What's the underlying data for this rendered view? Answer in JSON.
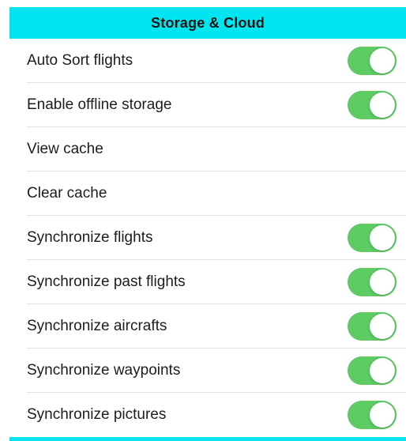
{
  "header": {
    "title": "Storage & Cloud"
  },
  "colors": {
    "header_bg": "#00e6f0",
    "toggle_on": "#5ecb63",
    "divider": "#e3e3e3"
  },
  "settings": [
    {
      "label": "Auto Sort flights",
      "has_toggle": true,
      "on": true
    },
    {
      "label": "Enable offline storage",
      "has_toggle": true,
      "on": true
    },
    {
      "label": "View cache",
      "has_toggle": false
    },
    {
      "label": "Clear cache",
      "has_toggle": false
    },
    {
      "label": "Synchronize flights",
      "has_toggle": true,
      "on": true
    },
    {
      "label": "Synchronize past flights",
      "has_toggle": true,
      "on": true
    },
    {
      "label": "Synchronize aircrafts",
      "has_toggle": true,
      "on": true
    },
    {
      "label": "Synchronize waypoints",
      "has_toggle": true,
      "on": true
    },
    {
      "label": "Synchronize pictures",
      "has_toggle": true,
      "on": true
    }
  ]
}
